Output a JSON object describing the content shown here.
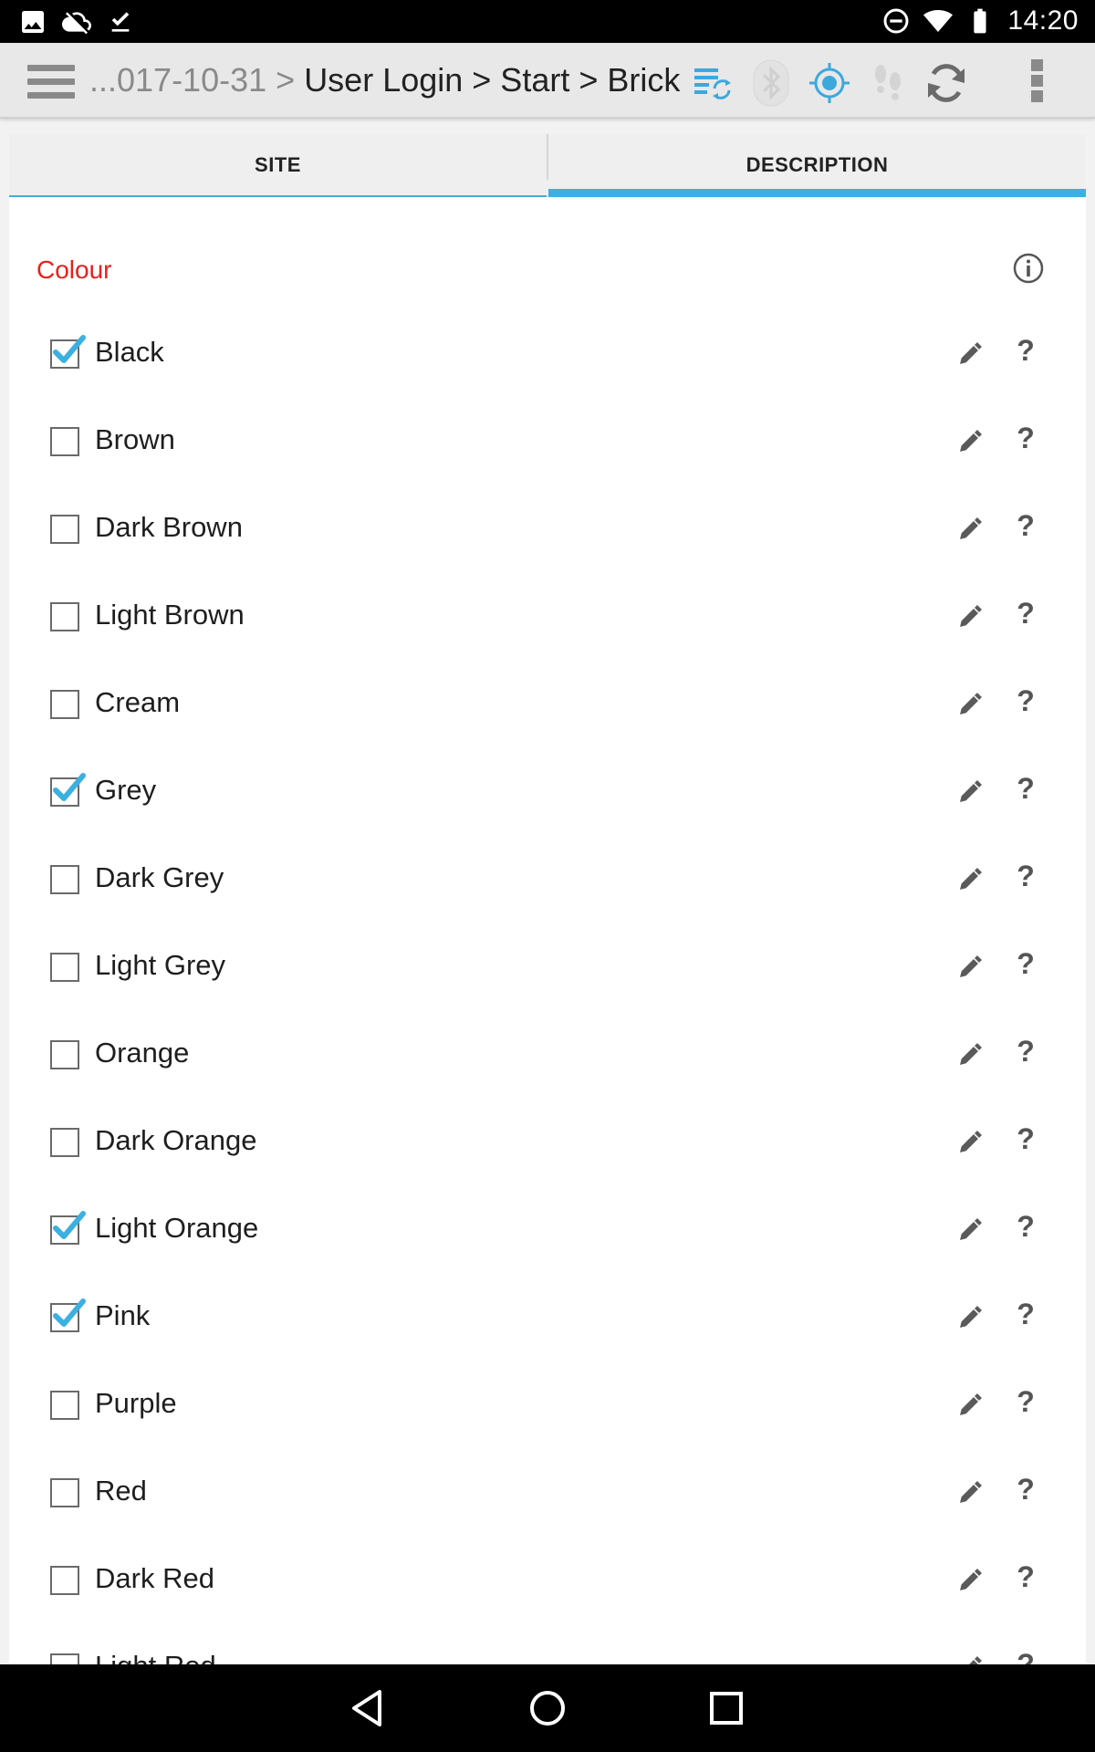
{
  "status_bar": {
    "time": "14:20",
    "left_icons": [
      "image-icon",
      "cloud-icon",
      "download-done-icon"
    ],
    "right_icons": [
      "do-not-disturb-icon",
      "wifi-icon",
      "battery-icon"
    ]
  },
  "toolbar": {
    "breadcrumb_dim": "...017-10-31 >",
    "breadcrumb_main": "User Login > Start > Brick",
    "icons": [
      "sync-list-icon",
      "bluetooth-icon",
      "gps-target-icon",
      "footsteps-icon",
      "refresh-icon"
    ],
    "accent_color": "#3cb0e0"
  },
  "tabs": [
    {
      "label": "SITE",
      "selected": false
    },
    {
      "label": "DESCRIPTION",
      "selected": true
    }
  ],
  "section": {
    "title": "Colour",
    "title_color": "#e8201c"
  },
  "colour_options": [
    {
      "label": "Black",
      "checked": true
    },
    {
      "label": "Brown",
      "checked": false
    },
    {
      "label": "Dark Brown",
      "checked": false
    },
    {
      "label": "Light Brown",
      "checked": false
    },
    {
      "label": "Cream",
      "checked": false
    },
    {
      "label": "Grey",
      "checked": true
    },
    {
      "label": "Dark Grey",
      "checked": false
    },
    {
      "label": "Light Grey",
      "checked": false
    },
    {
      "label": "Orange",
      "checked": false
    },
    {
      "label": "Dark Orange",
      "checked": false
    },
    {
      "label": "Light Orange",
      "checked": true
    },
    {
      "label": "Pink",
      "checked": true
    },
    {
      "label": "Purple",
      "checked": false
    },
    {
      "label": "Red",
      "checked": false
    },
    {
      "label": "Dark Red",
      "checked": false
    },
    {
      "label": "Light Red",
      "checked": false
    }
  ],
  "row_help_glyph": "?",
  "nav_bar": {
    "buttons": [
      "back-icon",
      "home-icon",
      "recents-icon"
    ]
  }
}
